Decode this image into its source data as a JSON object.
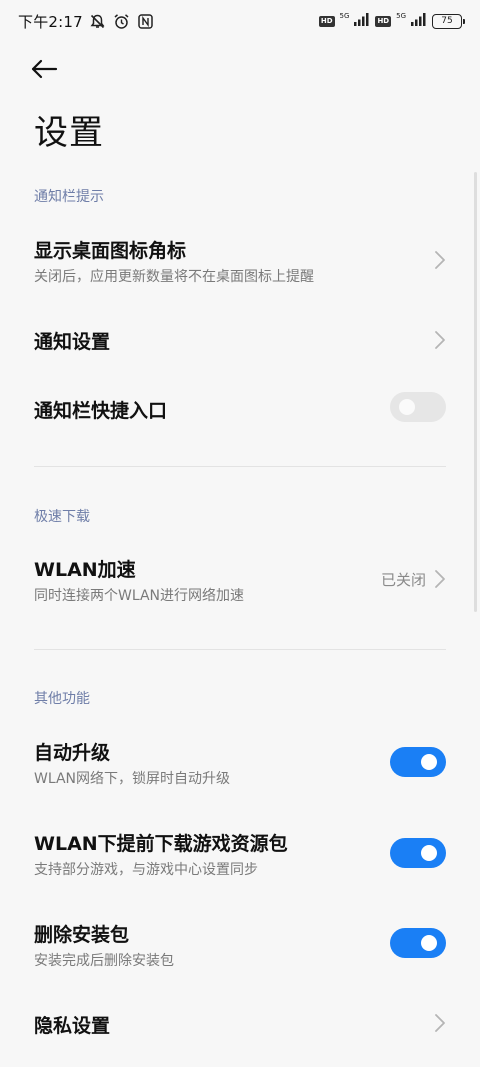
{
  "status_bar": {
    "time": "下午2:17",
    "sim1_network": "5G",
    "sim2_network": "5G",
    "hd_label": "HD",
    "battery": "75",
    "icons": [
      "mute-bell-icon",
      "alarm-icon",
      "nfc-icon",
      "signal-icon",
      "battery-icon"
    ]
  },
  "header": {
    "title": "设置"
  },
  "sections": {
    "notification": {
      "header": "通知栏提示",
      "desktop_badge": {
        "title": "显示桌面图标角标",
        "subtitle": "关闭后，应用更新数量将不在桌面图标上提醒"
      },
      "notification_settings": {
        "title": "通知设置"
      },
      "shortcut": {
        "title": "通知栏快捷入口",
        "enabled": false
      }
    },
    "download": {
      "header": "极速下载",
      "wlan_boost": {
        "title": "WLAN加速",
        "subtitle": "同时连接两个WLAN进行网络加速",
        "value": "已关闭"
      }
    },
    "other": {
      "header": "其他功能",
      "auto_upgrade": {
        "title": "自动升级",
        "subtitle": "WLAN网络下，锁屏时自动升级",
        "enabled": true
      },
      "predownload": {
        "title": "WLAN下提前下载游戏资源包",
        "subtitle": "支持部分游戏，与游戏中心设置同步",
        "enabled": true
      },
      "delete_package": {
        "title": "删除安装包",
        "subtitle": "安装完成后删除安装包",
        "enabled": true
      },
      "privacy": {
        "title": "隐私设置"
      }
    }
  },
  "colors": {
    "accent": "#1a7ff5",
    "section_header": "#6f7ea8",
    "background": "#f7f7f7"
  }
}
